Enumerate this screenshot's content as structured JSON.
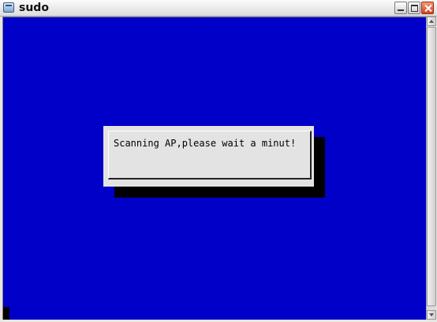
{
  "window": {
    "title": "sudo",
    "icon": "terminal-window-icon",
    "controls": {
      "minimize": "minimize-icon",
      "maximize": "maximize-icon",
      "close": "close-icon"
    }
  },
  "terminal": {
    "background_color": "#0000c8",
    "dialog": {
      "message": "Scanning AP,please wait a minut!"
    }
  },
  "scrollbar": {
    "up_icon": "arrow-up-icon",
    "down_icon": "arrow-down-icon"
  }
}
